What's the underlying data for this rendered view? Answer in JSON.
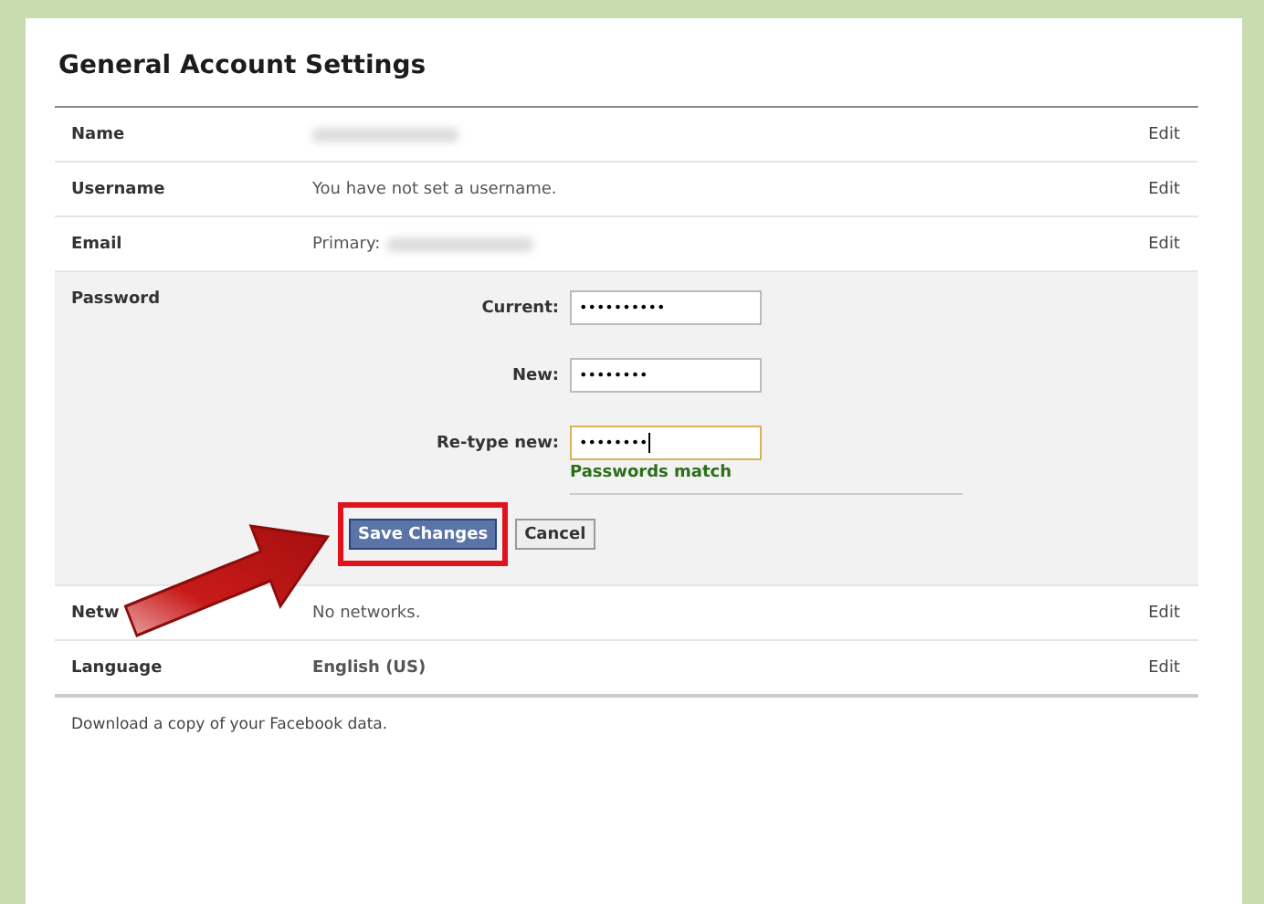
{
  "title": "General Account Settings",
  "rows": [
    {
      "kind": "plain",
      "label": "Name",
      "value_blurred": true,
      "edit": "Edit"
    },
    {
      "kind": "plain",
      "label": "Username",
      "value": "You have not set a username.",
      "edit": "Edit"
    },
    {
      "kind": "plain",
      "label": "Email",
      "value": "Primary:",
      "value_blurred": true,
      "edit": "Edit"
    },
    {
      "kind": "password",
      "label": "Password",
      "fields": [
        {
          "label": "Current:",
          "value": "••••••••••",
          "focused": false
        },
        {
          "label": "New:",
          "value": "••••••••",
          "focused": false
        },
        {
          "label": "Re-type new:",
          "value": "••••••••",
          "focused": true
        }
      ],
      "status": "Passwords match",
      "buttons": [
        {
          "label": "Save Changes",
          "kind": "primary",
          "highlighted": true
        },
        {
          "label": "Cancel",
          "kind": "secondary",
          "highlighted": false
        }
      ]
    },
    {
      "kind": "plain",
      "label": "Netw",
      "value": "No networks.",
      "edit": "Edit"
    },
    {
      "kind": "plain",
      "label": "Language",
      "value": "English (US)",
      "value_bold": true,
      "edit": "Edit"
    }
  ],
  "footer": "Download a copy of your Facebook data."
}
